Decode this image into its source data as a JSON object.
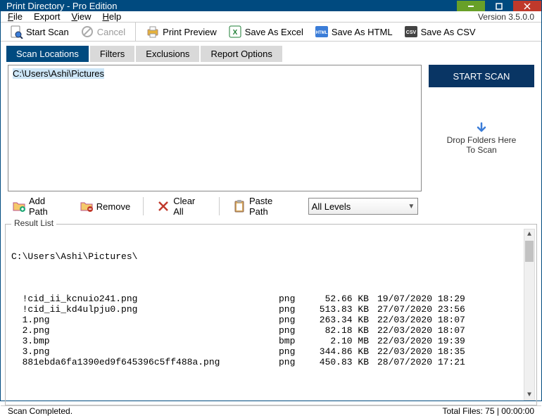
{
  "window": {
    "title": "Print Directory - Pro Edition"
  },
  "menu": {
    "file": "File",
    "export": "Export",
    "view": "View",
    "help": "Help"
  },
  "version": "Version 3.5.0.0",
  "toolbar": {
    "start_scan": "Start Scan",
    "cancel": "Cancel",
    "print_preview": "Print Preview",
    "save_excel": "Save As Excel",
    "save_html": "Save As HTML",
    "save_csv": "Save As CSV"
  },
  "tabs": {
    "scan_locations": "Scan Locations",
    "filters": "Filters",
    "exclusions": "Exclusions",
    "report_options": "Report Options"
  },
  "paths": {
    "selected": "C:\\Users\\Ashi\\Pictures"
  },
  "right": {
    "start_scan": "START SCAN",
    "drop_line1": "Drop Folders Here",
    "drop_line2": "To Scan"
  },
  "paths_toolbar": {
    "add_path": "Add Path",
    "remove": "Remove",
    "clear_all": "Clear All",
    "paste_path": "Paste Path",
    "levels": "All Levels"
  },
  "result": {
    "legend": "Result List",
    "header_path": "C:\\Users\\Ashi\\Pictures\\",
    "rows": [
      {
        "name": "!cid_ii_kcnuio241.png",
        "ext": "png",
        "size": "52.66 KB",
        "date": "19/07/2020 18:29"
      },
      {
        "name": "!cid_ii_kd4ulpju0.png",
        "ext": "png",
        "size": "513.83 KB",
        "date": "27/07/2020 23:56"
      },
      {
        "name": "1.png",
        "ext": "png",
        "size": "263.34 KB",
        "date": "22/03/2020 18:07"
      },
      {
        "name": "2.png",
        "ext": "png",
        "size": "82.18 KB",
        "date": "22/03/2020 18:07"
      },
      {
        "name": "3.bmp",
        "ext": "bmp",
        "size": "2.10 MB",
        "date": "22/03/2020 19:39"
      },
      {
        "name": "3.png",
        "ext": "png",
        "size": "344.86 KB",
        "date": "22/03/2020 18:35"
      },
      {
        "name": "881ebda6fa1390ed9f645396c5ff488a.png",
        "ext": "png",
        "size": "450.83 KB",
        "date": "28/07/2020 17:21"
      }
    ]
  },
  "status": {
    "message": "Scan Completed.",
    "totals": "Total Files: 75  |  00:00:00"
  }
}
